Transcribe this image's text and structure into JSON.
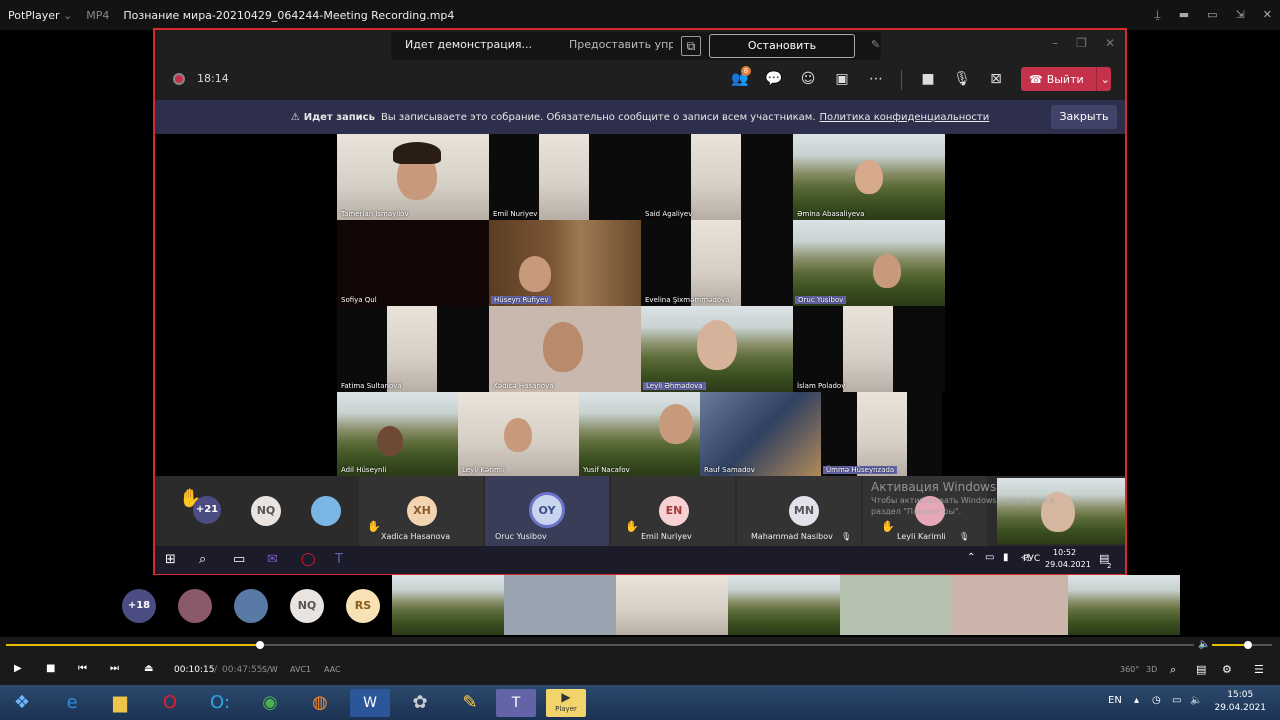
{
  "potplayer": {
    "app_name": "PotPlayer",
    "format": "MP4",
    "file_name": "Познание мира-20210429_064244-Meeting Recording.mp4"
  },
  "teams": {
    "share_bar": {
      "status": "Идет демонстрация...",
      "give_control": "Предоставить управл",
      "stop_sharing": "Остановить демонстрацию"
    },
    "toolbar": {
      "timer": "18:14",
      "participants_badge": "8",
      "leave_label": "Выйти"
    },
    "recording_banner": {
      "title": "Идет запись",
      "message": "Вы записываете это собрание. Обязательно сообщите о записи всем участникам.",
      "link": "Политика конфиденциальности",
      "close_label": "Закрыть"
    },
    "video_tiles": [
      {
        "name": "Tamerlan Ismayilov"
      },
      {
        "name": "Emil Nuriyev"
      },
      {
        "name": "Said Agaliyev"
      },
      {
        "name": "Əmina Abasaliyeva"
      },
      {
        "name": "Sofiya Qul"
      },
      {
        "name": "Hüseyn Rufiyev"
      },
      {
        "name": "Evelina Şixməmmədova"
      },
      {
        "name": "Oruc Yusibov"
      },
      {
        "name": "Fatima Sultanova"
      },
      {
        "name": "Xədicə Hasanova"
      },
      {
        "name": "Leyli Əhmədova"
      },
      {
        "name": "İslam Poladov"
      },
      {
        "name": "Adil Hüseynli"
      },
      {
        "name": "Leyli Kərimli"
      },
      {
        "name": "Yusif Nacafov"
      },
      {
        "name": "Rauf Samadov"
      },
      {
        "name": "Ümmə Hüseynzada"
      }
    ],
    "participant_strip": {
      "overflow_count": "+21",
      "participants": [
        {
          "initials": "NQ",
          "name": ""
        },
        {
          "initials": "XH",
          "name": "Xadica Hasanova"
        },
        {
          "initials": "OY",
          "name": "Oruc Yusibov"
        },
        {
          "initials": "EN",
          "name": "Emil Nuriyev"
        },
        {
          "initials": "MN",
          "name": "Mahammad Nasibov"
        },
        {
          "initials": "",
          "name": "Leyli Karimli"
        }
      ]
    },
    "activation": {
      "title": "Активация Windows",
      "line1": "Чтобы активировать Windows, перейдите в",
      "line2": "раздел \"Параметры\"."
    },
    "inner_taskbar": {
      "lang": "РУС",
      "time": "10:52",
      "date": "29.04.2021",
      "notif_count": "2"
    }
  },
  "bottom_gallery": {
    "overflow_count": "+18",
    "initials": [
      "NQ",
      "RS"
    ]
  },
  "player_controls": {
    "current_time": "00:10:15",
    "separator": "/",
    "total_time": "00:47:55",
    "tags": [
      "S/W",
      "AVC1",
      "AAC"
    ],
    "progress_fraction": 0.214,
    "volume_fraction": 0.6,
    "right_labels": [
      "360°",
      "3D"
    ]
  },
  "taskbar": {
    "lang": "EN",
    "time": "15:05",
    "date": "29.04.2021",
    "potplayer_label": "Player"
  },
  "colors": {
    "leave_red": "#c4314b",
    "teams_purple": "#6264a7",
    "banner_bg": "#2d2f4c",
    "seek_yellow": "#e6c000",
    "frame_red": "#d52b2b"
  }
}
